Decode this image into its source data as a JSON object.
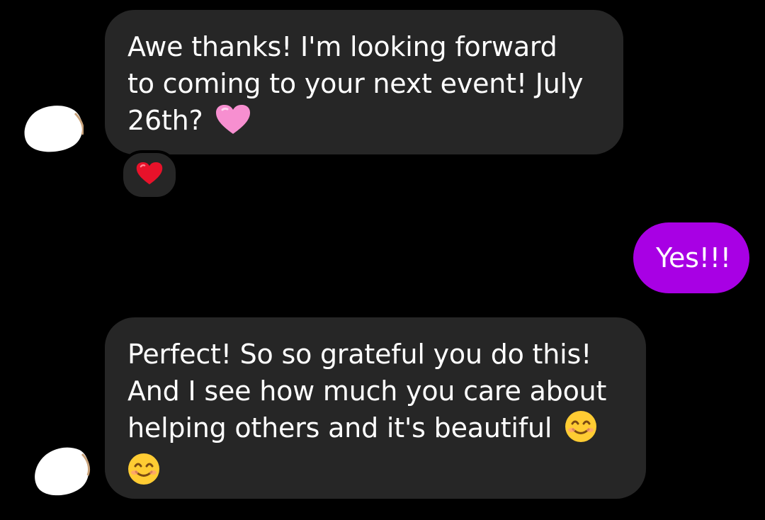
{
  "messages": [
    {
      "sender": "them",
      "lines": [
        "Awe thanks! I'm looking forward",
        "to coming to your next event! July",
        "26th?"
      ],
      "trailing_emoji": "pink-heart",
      "reaction": "red-heart"
    },
    {
      "sender": "me",
      "lines": [
        "Yes!!!"
      ]
    },
    {
      "sender": "them",
      "lines": [
        "Perfect! So so grateful you do this!",
        "And I see how much you care about",
        "helping others and it's beautiful"
      ],
      "trailing_emoji": "smiling-face-with-smiling-eyes",
      "next_line_emoji": "smiling-face-with-smiling-eyes"
    }
  ],
  "colors": {
    "background": "#000000",
    "incoming_bubble": "#262626",
    "outgoing_bubble": "#a800e4",
    "text": "#ffffff"
  }
}
